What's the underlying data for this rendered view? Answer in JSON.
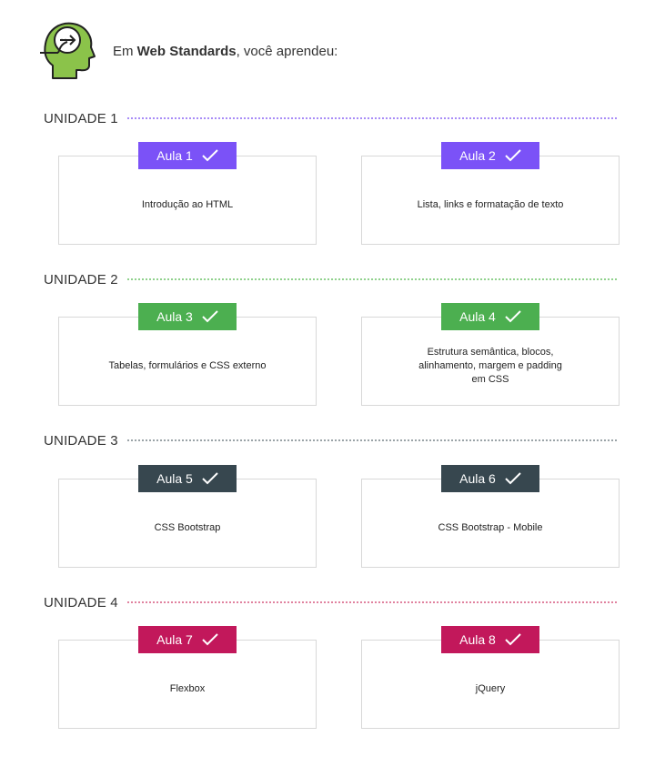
{
  "intro": {
    "prefix": "Em ",
    "course": "Web Standards",
    "suffix": ", você aprendeu:"
  },
  "colors": {
    "unit1": "#7b52f7",
    "unit2": "#4caf50",
    "unit3": "#37474f",
    "unit4": "#c2185b"
  },
  "units": [
    {
      "label": "UNIDADE 1",
      "lessons": [
        {
          "badge": "Aula 1",
          "text": "Introdução  ao HTML"
        },
        {
          "badge": "Aula 2",
          "text": "Lista, links e formatação  de texto"
        }
      ]
    },
    {
      "label": "UNIDADE 2",
      "lessons": [
        {
          "badge": "Aula 3",
          "text": "Tabelas, formulários  e CSS externo"
        },
        {
          "badge": "Aula 4",
          "text": "Estrutura  semântica,  blocos,\nalinhamento,  margem  e padding\nem CSS"
        }
      ]
    },
    {
      "label": "UNIDADE 3",
      "lessons": [
        {
          "badge": "Aula 5",
          "text": "CSS Bootstrap"
        },
        {
          "badge": "Aula 6",
          "text": "CSS Bootstrap  - Mobile"
        }
      ]
    },
    {
      "label": "UNIDADE 4",
      "lessons": [
        {
          "badge": "Aula 7",
          "text": "Flexbox"
        },
        {
          "badge": "Aula 8",
          "text": "jQuery"
        }
      ]
    }
  ]
}
